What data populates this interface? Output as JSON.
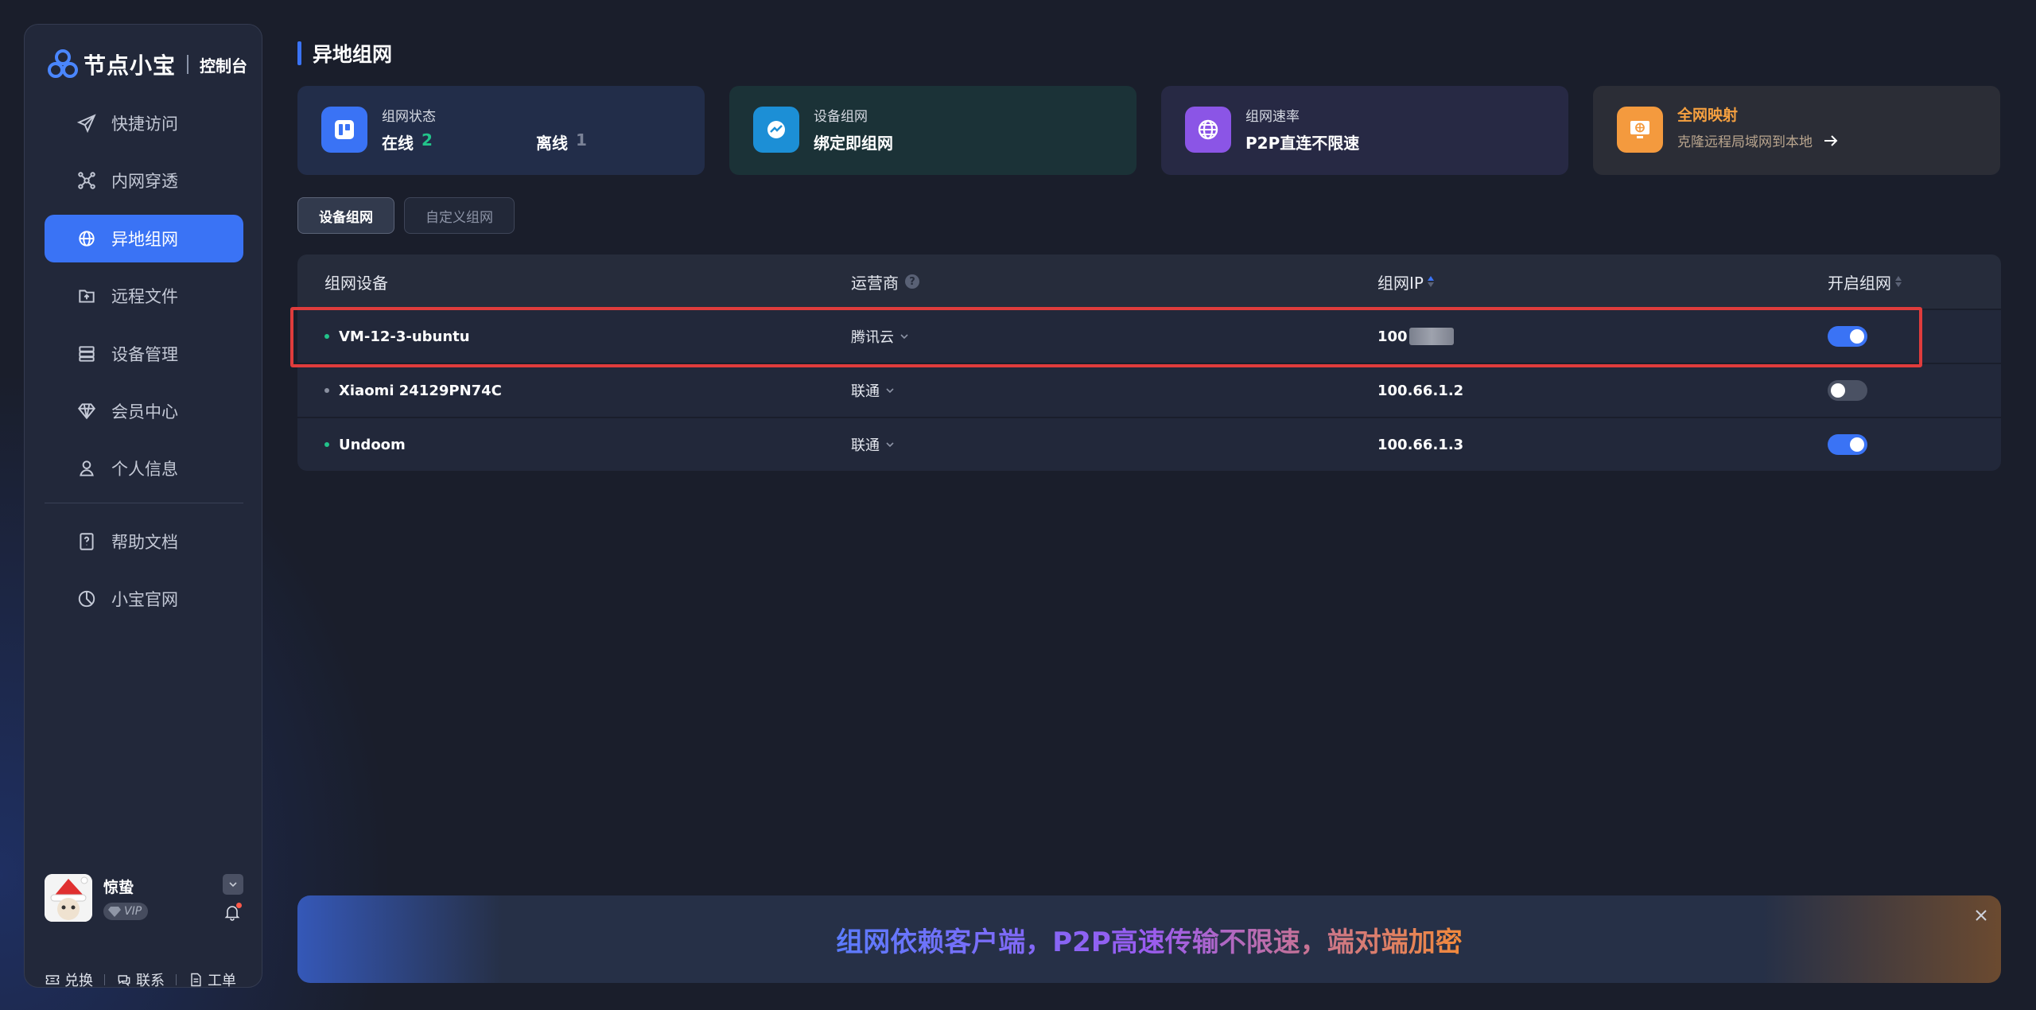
{
  "sidebar": {
    "logo_text": "节点小宝",
    "logo_sub": "控制台",
    "items": [
      {
        "label": "快捷访问",
        "icon": "paper-plane-icon"
      },
      {
        "label": "内网穿透",
        "icon": "network-nodes-icon"
      },
      {
        "label": "异地组网",
        "icon": "globe-network-icon",
        "active": true
      },
      {
        "label": "远程文件",
        "icon": "folder-upload-icon"
      },
      {
        "label": "设备管理",
        "icon": "server-icon"
      },
      {
        "label": "会员中心",
        "icon": "diamond-icon"
      },
      {
        "label": "个人信息",
        "icon": "user-icon"
      }
    ],
    "items2": [
      {
        "label": "帮助文档",
        "icon": "help-doc-icon"
      },
      {
        "label": "小宝官网",
        "icon": "compass-icon"
      }
    ],
    "user": {
      "name": "惊蛰",
      "badge": "VIP"
    },
    "actions": [
      "兑换",
      "联系",
      "工单"
    ]
  },
  "page": {
    "title": "异地组网"
  },
  "cards": [
    {
      "label": "组网状态",
      "online_label": "在线",
      "online": "2",
      "offline_label": "离线",
      "offline": "1",
      "color": "#3a73f5"
    },
    {
      "label": "设备组网",
      "value": "绑定即组网",
      "color": "#1c8fd6"
    },
    {
      "label": "组网速率",
      "value": "P2P直连不限速",
      "color": "#8b55e6"
    },
    {
      "label": "全网映射",
      "value": "克隆远程局域网到本地",
      "color": "#f49a3e"
    }
  ],
  "tabs": [
    "设备组网",
    "自定义组网"
  ],
  "table": {
    "headers": [
      "组网设备",
      "运营商",
      "组网IP",
      "开启组网"
    ],
    "rows": [
      {
        "device": "VM-12-3-ubuntu",
        "isp": "腾讯云",
        "ip": "100",
        "enabled": true,
        "online": true
      },
      {
        "device": "Xiaomi 24129PN74C",
        "isp": "联通",
        "ip": "100.66.1.2",
        "enabled": false,
        "online": false
      },
      {
        "device": "Undoom",
        "isp": "联通",
        "ip": "100.66.1.3",
        "enabled": true,
        "online": true
      }
    ]
  },
  "banner": {
    "text": "组网依赖客户端，P2P高速传输不限速，端对端加密"
  }
}
